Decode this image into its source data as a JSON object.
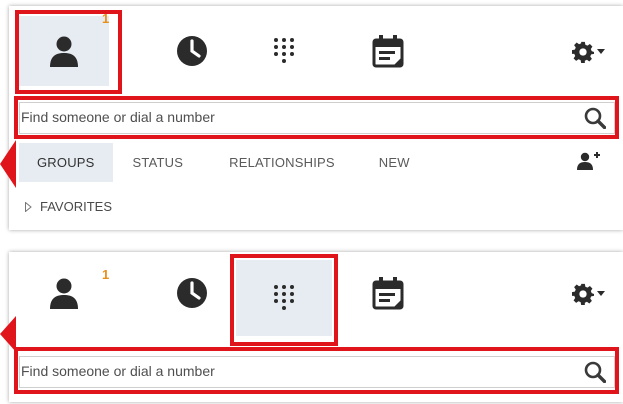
{
  "panel1": {
    "notification_count": "1",
    "search_placeholder": "Find someone or dial a number",
    "subtabs": [
      "GROUPS",
      "STATUS",
      "RELATIONSHIPS",
      "NEW"
    ],
    "favorites_label": "FAVORITES"
  },
  "panel2": {
    "notification_count": "1",
    "search_placeholder": "Find someone or dial a number"
  },
  "colors": {
    "highlight": "#e0151c",
    "active_tab_bg": "#e6ecf2",
    "badge": "#e8901a",
    "icon": "#2b2b2b"
  },
  "icons": [
    "contacts-icon",
    "clock-icon",
    "dialpad-icon",
    "meetings-icon",
    "gear-icon",
    "search-icon",
    "add-contact-icon"
  ]
}
